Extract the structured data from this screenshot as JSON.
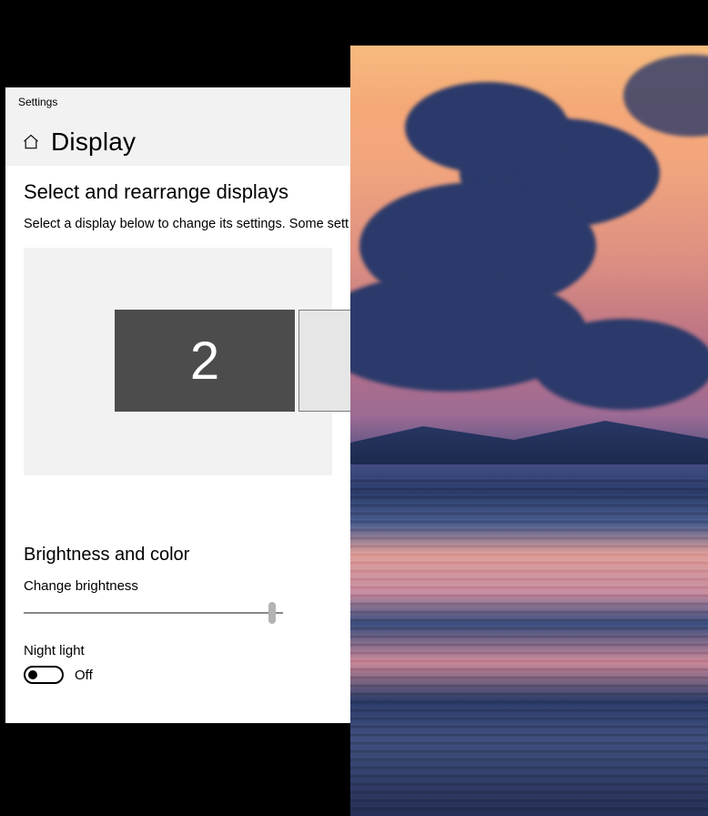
{
  "window": {
    "title": "Settings"
  },
  "header": {
    "page_title": "Display"
  },
  "rearrange": {
    "heading": "Select and rearrange displays",
    "description": "Select a display below to change its settings. Some sett",
    "monitors": [
      {
        "label": "2",
        "selected": true
      },
      {
        "label": "",
        "selected": false
      }
    ]
  },
  "brightness": {
    "heading": "Brightness and color",
    "slider_label": "Change brightness",
    "slider_value_percent": 97
  },
  "night_light": {
    "label": "Night light",
    "state_text": "Off",
    "enabled": false
  }
}
